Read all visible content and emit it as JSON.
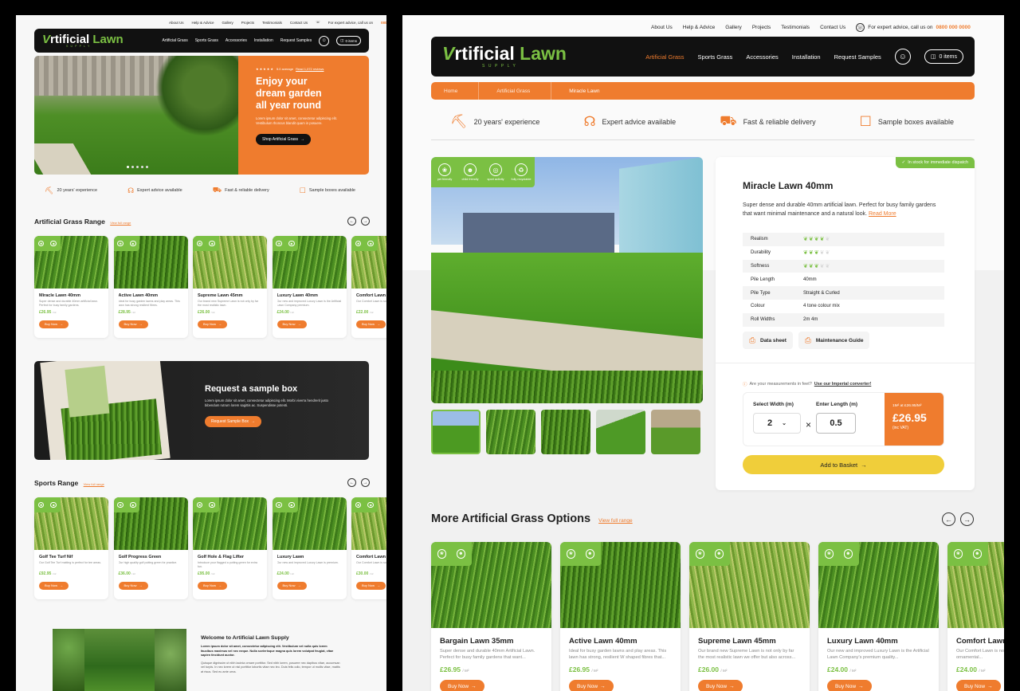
{
  "colors": {
    "accent": "#ef7c2e",
    "brand_green": "#7bc043",
    "nav_bg": "#111111"
  },
  "top_links": [
    "About Us",
    "Help & Advice",
    "Gallery",
    "Projects",
    "Testimonials",
    "Contact Us"
  ],
  "phone_prefix": "For expert advice, call us on",
  "phone": "0800 000 0000",
  "brand": {
    "word1": "rtificial",
    "word2": "Lawn",
    "tagline": "SUPPLY"
  },
  "menu": [
    "Artificial Grass",
    "Sports Grass",
    "Accessories",
    "Installation",
    "Request Samples"
  ],
  "basket": "0 items",
  "usps": [
    "20 years' experience",
    "Expert advice available",
    "Fast & reliable delivery",
    "Sample boxes available"
  ],
  "left": {
    "hero": {
      "rating_text": "5.0 average",
      "reviews": "Read 1,072 reviews",
      "title": "Enjoy your dream garden all year round",
      "text": "Lorem ipsum dolor sit amet, consectetur adipiscing elit. Vestibulum rhoncus blandit quam in posuere.",
      "button": "Shop Artificial Grass"
    },
    "range_title": "Artificial Grass Range",
    "range_link": "View full range",
    "products": [
      {
        "name": "Miracle Lawn 40mm",
        "desc": "Super dense and durable 40mm artificial lawn. Perfect for busy family gardens.",
        "price": "£26.95",
        "unit": "/ m²"
      },
      {
        "name": "Active Lawn 40mm",
        "desc": "Ideal for busy garden lawns and play areas. This lawn has strong resilient fibres.",
        "price": "£28.95",
        "unit": "/ m²"
      },
      {
        "name": "Supreme Lawn 45mm",
        "desc": "Our brand new Supreme Lawn is not only by far the most realistic lawn.",
        "price": "£26.00",
        "unit": "/ m²"
      },
      {
        "name": "Luxury Lawn 40mm",
        "desc": "Our new and improved Luxury Lawn is the Artificial Lawn Company premium.",
        "price": "£24.00",
        "unit": "/ m²"
      },
      {
        "name": "Comfort Lawn",
        "desc": "Our Comfort Lawn is soft.",
        "price": "£22.00",
        "unit": "/ m²"
      }
    ],
    "buy": "Buy Now",
    "sample": {
      "title": "Request a sample box",
      "text": "Lorem ipsum dolor sit amet, consectetur adipiscing elit. Morbi viverra hendrerit justo bibendum rutrum lorem sagittis ac. Suspendisse potenti.",
      "button": "Request Sample Box"
    },
    "sports_title": "Sports Range",
    "sports_link": "View full range",
    "sports": [
      {
        "name": "Golf Tee Turf Nif",
        "desc": "Our Golf Tee Turf matting is perfect for tee areas.",
        "price": "£92.95",
        "unit": "/ m²"
      },
      {
        "name": "Golf Progress Green",
        "desc": "Our high quality golf putting green for practice.",
        "price": "£36.00",
        "unit": "/ m²"
      },
      {
        "name": "Golf Hole & Flag Lifter",
        "desc": "Introduce your flagged a putting green for extra fun.",
        "price": "£95.00",
        "unit": "/ m²"
      },
      {
        "name": "Luxury Lawn",
        "desc": "Our new and improved Luxury Lawn is premium.",
        "price": "£24.00",
        "unit": "/ m²"
      },
      {
        "name": "Comfort Lawn",
        "desc": "Our Comfort Lawn is soft.",
        "price": "£30.00",
        "unit": "/ m²"
      }
    ],
    "welcome": {
      "title": "Welcome to Artificial Lawn Supply",
      "bold": "Lorem ipsum dolor sit amet, consectetur adipiscing elit. Vestibulum vel nulla quis lorem faucibus maximus vel nec neque. Nulla scelerisque magna quis lorem volutpat feugiat, vitae sapien tincidunt auctor.",
      "text": "Quisque dignissim ut nibh lacinia ornare porttitor. Sed nibh lorem, posuere nec dapibus vitae, accumsan vel turpis. In nec lorem ut nisl porttitor lobortis vitae nec leo. Duis felis odio, tempor ut mollis vitae, mattis at risus. Sed eu ante urna."
    }
  },
  "right": {
    "breadcrumb": [
      "Home",
      "Artificial Grass",
      "Miracle Lawn"
    ],
    "feature_badges": [
      "pet friendly",
      "child friendly",
      "sport activity",
      "fully recyclable"
    ],
    "stock": "In stock for immediate dispatch",
    "product_title": "Miracle Lawn 40mm",
    "product_desc": "Super dense and durable 40mm artificial lawn. Perfect for busy family gardens that want minimal maintenance and a natural look.",
    "read_more": "Read More",
    "attributes": [
      {
        "label": "Realism",
        "value": "",
        "stars": 4
      },
      {
        "label": "Durability",
        "value": "",
        "stars": 3
      },
      {
        "label": "Softness",
        "value": "",
        "stars": 3
      },
      {
        "label": "Pile Length",
        "value": "40mm"
      },
      {
        "label": "Pile Type",
        "value": "Straight & Curled"
      },
      {
        "label": "Colour",
        "value": "4 tone colour mix"
      },
      {
        "label": "Roll Widths",
        "value": "2m 4m"
      }
    ],
    "data_sheet": "Data sheet",
    "maintenance": "Maintenance Guide",
    "measure_note": "Are your measurements in feet?",
    "measure_link": "Use our Imperial converter!",
    "width_label": "Select Width (m)",
    "width_value": "2",
    "length_label": "Enter Length (m)",
    "length_value": "0.5",
    "price_per": "1M² at £26.95/M²",
    "price": "£26.95",
    "vat": "(inc VAT)",
    "add_basket": "Add to Basket",
    "more_title": "More Artificial Grass Options",
    "more_link": "View full range",
    "more": [
      {
        "name": "Bargain Lawn 35mm",
        "desc": "Super dense and durable 40mm Artificial Lawn. Perfect for busy family gardens that want...",
        "price": "£26.95",
        "unit": "/ M²"
      },
      {
        "name": "Active Lawn 40mm",
        "desc": "Ideal for busy garden lawns and play areas. This lawn has strong, resilient W shaped fibres that...",
        "price": "£26.95",
        "unit": "/ M²"
      },
      {
        "name": "Supreme Lawn 45mm",
        "desc": "Our brand new Supreme Lawn is not only by far the most realistic lawn we offer but also across...",
        "price": "£26.00",
        "unit": "/ M²"
      },
      {
        "name": "Luxury Lawn 40mm",
        "desc": "Our new and improved Luxury Lawn is the Artificial Lawn Company's premium quality...",
        "price": "£24.00",
        "unit": "/ M²"
      },
      {
        "name": "Comfort Lawn",
        "desc": "Our Comfort Lawn is not only by far, ideal for ornamental...",
        "price": "£24.00",
        "unit": "/ M²"
      }
    ],
    "buy": "Buy Now"
  }
}
